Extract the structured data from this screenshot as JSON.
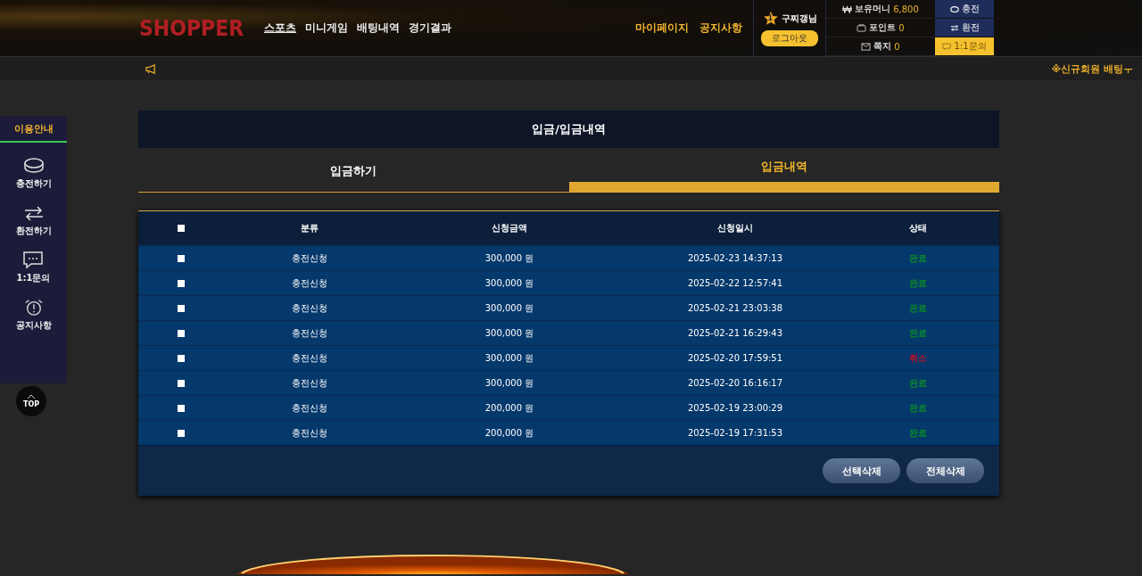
{
  "header": {
    "logo": "SHOPPER",
    "nav": [
      {
        "label": "스포츠",
        "selected": true
      },
      {
        "label": "미니게임",
        "selected": false
      },
      {
        "label": "배팅내역",
        "selected": false
      },
      {
        "label": "경기결과",
        "selected": false
      }
    ],
    "links": [
      "마이페이지",
      "공지사항"
    ],
    "user": {
      "badge": "1",
      "name": "구찌갱님",
      "logout": "로그아웃"
    },
    "wallet": [
      {
        "kind": "money",
        "label": "보유머니",
        "value": "6,800"
      },
      {
        "kind": "point",
        "label": "포인트",
        "value": "0"
      },
      {
        "kind": "note",
        "label": "쪽지",
        "value": "0"
      }
    ],
    "actions": [
      {
        "kind": "charge",
        "label": "충전"
      },
      {
        "kind": "exchange",
        "label": "환전"
      },
      {
        "kind": "inquiry",
        "label": "1:1문의"
      }
    ]
  },
  "ticker": {
    "text": "※신규회원 배팅ㅜ"
  },
  "sidebar": {
    "title": "이용안내",
    "items": [
      {
        "kind": "coin",
        "label": "충전하기"
      },
      {
        "kind": "exchange",
        "label": "환전하기"
      },
      {
        "kind": "chat",
        "label": "1:1문의"
      },
      {
        "kind": "alarm",
        "label": "공지사항"
      }
    ],
    "top": "TOP"
  },
  "panel": {
    "title": "입금/입금내역",
    "tabs": [
      {
        "label": "입금하기",
        "selected": false
      },
      {
        "label": "입금내역",
        "selected": true
      }
    ],
    "table": {
      "header_checked": false,
      "columns": [
        "분류",
        "신청금액",
        "신청일시",
        "상태"
      ],
      "rows": [
        {
          "checked": false,
          "type": "충전신청",
          "amount": "300,000 원",
          "date": "2025-02-23 14:37:13",
          "status": "완료",
          "color": "#0a8a2a"
        },
        {
          "checked": false,
          "type": "충전신청",
          "amount": "300,000 원",
          "date": "2025-02-22 12:57:41",
          "status": "완료",
          "color": "#0a8a2a"
        },
        {
          "checked": false,
          "type": "충전신청",
          "amount": "300,000 원",
          "date": "2025-02-21 23:03:38",
          "status": "완료",
          "color": "#0a8a2a"
        },
        {
          "checked": false,
          "type": "충전신청",
          "amount": "300,000 원",
          "date": "2025-02-21 16:29:43",
          "status": "완료",
          "color": "#0a8a2a"
        },
        {
          "checked": false,
          "type": "충전신청",
          "amount": "300,000 원",
          "date": "2025-02-20 17:59:51",
          "status": "취소",
          "color": "#c0102a"
        },
        {
          "checked": false,
          "type": "충전신청",
          "amount": "300,000 원",
          "date": "2025-02-20 16:16:17",
          "status": "완료",
          "color": "#0a8a2a"
        },
        {
          "checked": false,
          "type": "충전신청",
          "amount": "200,000 원",
          "date": "2025-02-19 23:00:29",
          "status": "완료",
          "color": "#0a8a2a"
        },
        {
          "checked": false,
          "type": "충전신청",
          "amount": "200,000 원",
          "date": "2025-02-19 17:31:53",
          "status": "완료",
          "color": "#0a8a2a"
        }
      ]
    },
    "buttons": [
      "선택삭제",
      "전체삭제"
    ]
  }
}
